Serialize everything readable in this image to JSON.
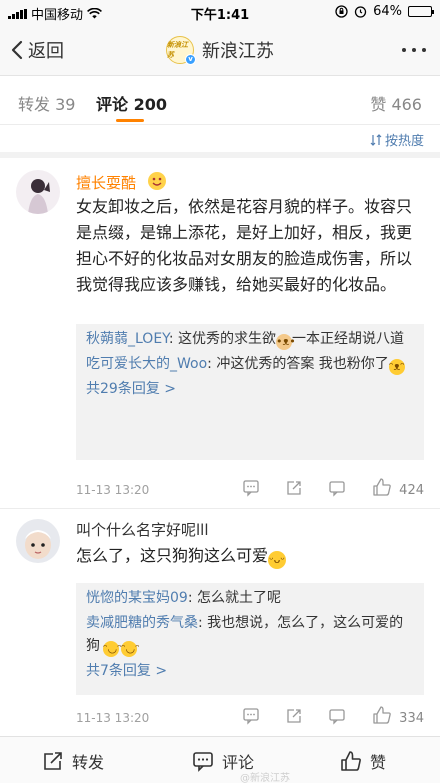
{
  "status_bar": {
    "carrier": "中国移动",
    "time": "下午1:41",
    "battery": "64%",
    "battery_level": 0.64
  },
  "nav": {
    "back_label": "返回",
    "title": "新浪江苏",
    "avatar_text": "新浪江苏"
  },
  "tabs": {
    "forward": "转发 39",
    "comment": "评论 200",
    "like": "赞 466"
  },
  "sort_label": "按热度",
  "comments": [
    {
      "name": "擅长耍酷",
      "name_color": "#ff8200",
      "text": "女友卸妆之后，依然是花容月貌的样子。妆容只是点缀，是锦上添花，是好上加好，相反，我更担心不好的化妆品对女朋友的脸造成伤害，所以我觉得我应该多赚钱，给她买最好的化妆品。",
      "replies": [
        {
          "name": "秋蒴蒻_LOEY",
          "text": ": 这优秀的求生欲",
          "text2": "一本正经胡说八道"
        },
        {
          "name": "吃可爱长大的_Woo",
          "text": ": 冲这优秀的答案 我也粉你了"
        }
      ],
      "more_replies": "共29条回复 >",
      "time": "11-13 13:20",
      "likes": "424"
    },
    {
      "name": "叫个什么名字好呢lll",
      "name_color": "#333333",
      "text": "怎么了，这只狗狗这么可爱",
      "replies": [
        {
          "name": "恍惚的某宝妈09",
          "text": ": 怎么就土了呢"
        },
        {
          "name": "卖减肥糖的秀气桑",
          "text": ": 我也想说，怎么了，这么可爱的狗"
        }
      ],
      "more_replies": "共7条回复 >",
      "time": "11-13 13:20",
      "likes": "334"
    }
  ],
  "bottom_bar": {
    "forward": "转发",
    "comment": "评论",
    "like": "赞"
  },
  "watermark": "@新浪江苏",
  "colors": {
    "accent": "#ff8200",
    "link": "#507daf"
  }
}
